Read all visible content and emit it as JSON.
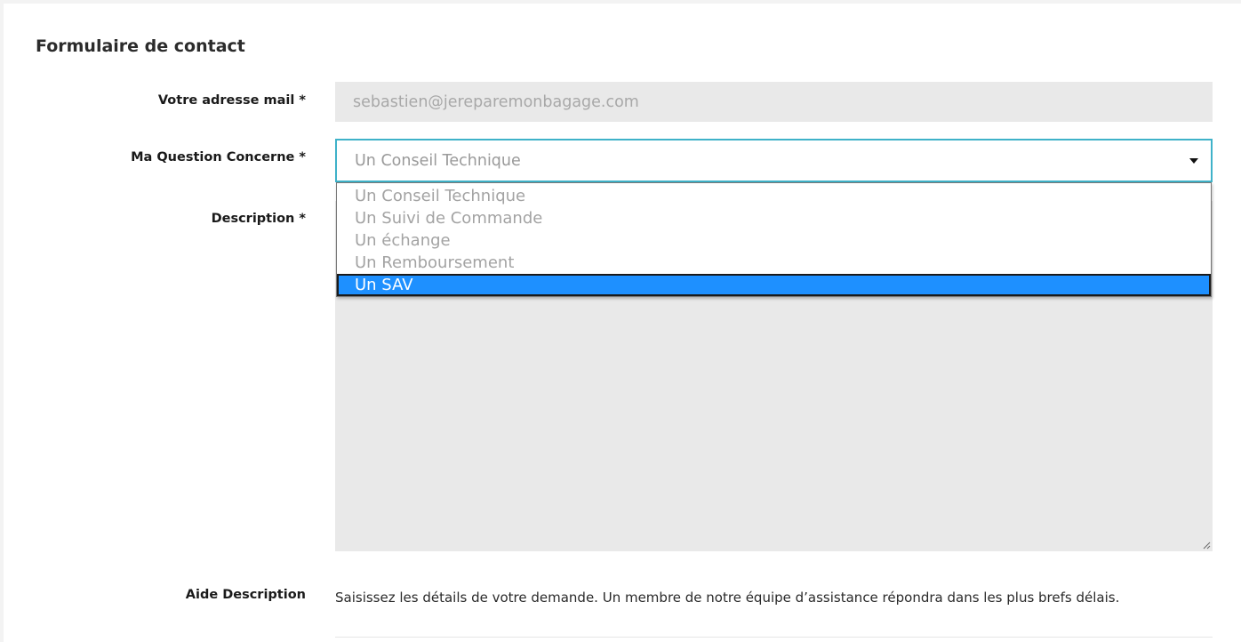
{
  "form": {
    "title": "Formulaire de contact"
  },
  "fields": {
    "email": {
      "label": "Votre adresse mail *",
      "value": "sebastien@jereparemonbagage.com"
    },
    "question": {
      "label": "Ma Question Concerne *",
      "value": "Un Conseil Technique",
      "options": [
        "Un Conseil Technique",
        "Un Suivi de Commande",
        "Un échange",
        "Un Remboursement",
        "Un SAV"
      ],
      "highlighted_option": "Un SAV"
    },
    "description": {
      "label": "Description *",
      "value": ""
    },
    "help": {
      "label": "Aide Description",
      "text": "Saisissez les détails de votre demande. Un membre de notre équipe d’assistance répondra dans les plus brefs délais."
    }
  },
  "colors": {
    "focus_border": "#3fb2c9",
    "highlight": "#1e90ff",
    "field_bg": "#e9e9e9"
  },
  "icons": {
    "select_arrow": "caret-down-icon",
    "resize_handle": "resize-grip-icon"
  }
}
